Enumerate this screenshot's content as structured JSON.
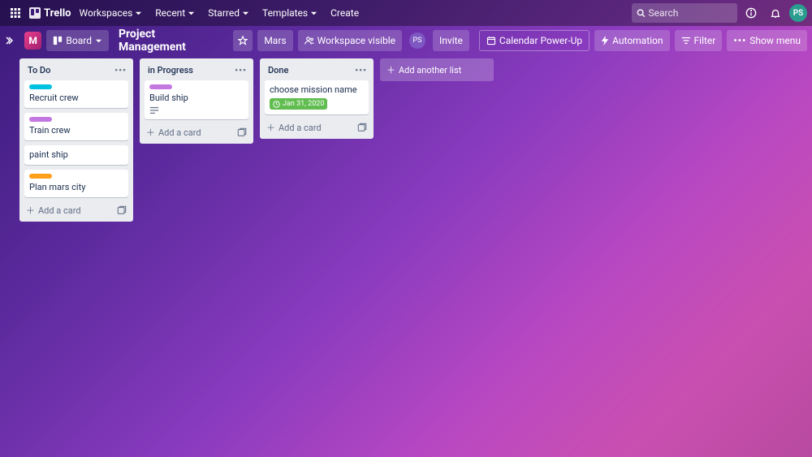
{
  "nav": {
    "logo": "Trello",
    "items": [
      "Workspaces",
      "Recent",
      "Starred",
      "Templates"
    ],
    "create": "Create",
    "search_placeholder": "Search",
    "avatar_initials": "PS"
  },
  "boardbar": {
    "workspace_initial": "M",
    "view_label": "Board",
    "title": "Project Management",
    "team": "Mars",
    "visibility": "Workspace visible",
    "member_initials": "PS",
    "invite": "Invite",
    "calendar": "Calendar Power-Up",
    "automation": "Automation",
    "filter": "Filter",
    "show_menu": "Show menu"
  },
  "lists": [
    {
      "name": "To Do",
      "cards": [
        {
          "label": "teal",
          "text": "Recruit crew"
        },
        {
          "label": "purple",
          "text": "Train crew"
        },
        {
          "label": null,
          "text": "paint ship"
        },
        {
          "label": "orange",
          "text": "Plan mars city"
        }
      ]
    },
    {
      "name": "in Progress",
      "cards": [
        {
          "label": "purple",
          "text": "Build ship",
          "has_desc": true
        }
      ]
    },
    {
      "name": "Done",
      "cards": [
        {
          "label": null,
          "text": "choose mission name",
          "date": "Jan 31, 2020"
        }
      ]
    }
  ],
  "strings": {
    "add_card": "Add a card",
    "add_list": "Add another list"
  }
}
